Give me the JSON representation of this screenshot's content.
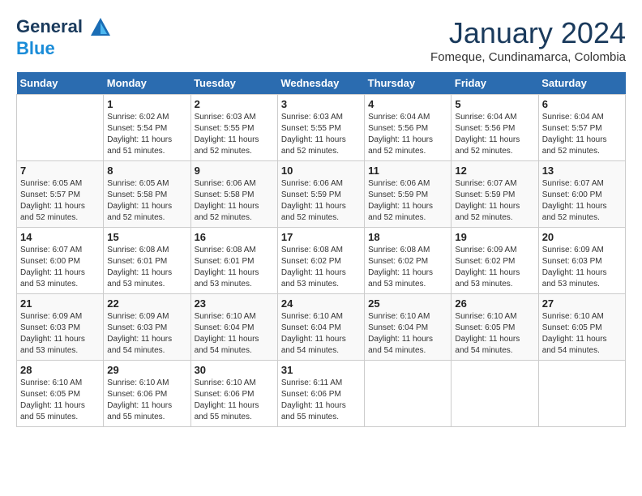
{
  "header": {
    "logo_line1": "General",
    "logo_line2": "Blue",
    "month": "January 2024",
    "location": "Fomeque, Cundinamarca, Colombia"
  },
  "weekdays": [
    "Sunday",
    "Monday",
    "Tuesday",
    "Wednesday",
    "Thursday",
    "Friday",
    "Saturday"
  ],
  "weeks": [
    [
      {
        "day": "",
        "sunrise": "",
        "sunset": "",
        "daylight": ""
      },
      {
        "day": "1",
        "sunrise": "Sunrise: 6:02 AM",
        "sunset": "Sunset: 5:54 PM",
        "daylight": "Daylight: 11 hours and 51 minutes."
      },
      {
        "day": "2",
        "sunrise": "Sunrise: 6:03 AM",
        "sunset": "Sunset: 5:55 PM",
        "daylight": "Daylight: 11 hours and 52 minutes."
      },
      {
        "day": "3",
        "sunrise": "Sunrise: 6:03 AM",
        "sunset": "Sunset: 5:55 PM",
        "daylight": "Daylight: 11 hours and 52 minutes."
      },
      {
        "day": "4",
        "sunrise": "Sunrise: 6:04 AM",
        "sunset": "Sunset: 5:56 PM",
        "daylight": "Daylight: 11 hours and 52 minutes."
      },
      {
        "day": "5",
        "sunrise": "Sunrise: 6:04 AM",
        "sunset": "Sunset: 5:56 PM",
        "daylight": "Daylight: 11 hours and 52 minutes."
      },
      {
        "day": "6",
        "sunrise": "Sunrise: 6:04 AM",
        "sunset": "Sunset: 5:57 PM",
        "daylight": "Daylight: 11 hours and 52 minutes."
      }
    ],
    [
      {
        "day": "7",
        "sunrise": "Sunrise: 6:05 AM",
        "sunset": "Sunset: 5:57 PM",
        "daylight": "Daylight: 11 hours and 52 minutes."
      },
      {
        "day": "8",
        "sunrise": "Sunrise: 6:05 AM",
        "sunset": "Sunset: 5:58 PM",
        "daylight": "Daylight: 11 hours and 52 minutes."
      },
      {
        "day": "9",
        "sunrise": "Sunrise: 6:06 AM",
        "sunset": "Sunset: 5:58 PM",
        "daylight": "Daylight: 11 hours and 52 minutes."
      },
      {
        "day": "10",
        "sunrise": "Sunrise: 6:06 AM",
        "sunset": "Sunset: 5:59 PM",
        "daylight": "Daylight: 11 hours and 52 minutes."
      },
      {
        "day": "11",
        "sunrise": "Sunrise: 6:06 AM",
        "sunset": "Sunset: 5:59 PM",
        "daylight": "Daylight: 11 hours and 52 minutes."
      },
      {
        "day": "12",
        "sunrise": "Sunrise: 6:07 AM",
        "sunset": "Sunset: 5:59 PM",
        "daylight": "Daylight: 11 hours and 52 minutes."
      },
      {
        "day": "13",
        "sunrise": "Sunrise: 6:07 AM",
        "sunset": "Sunset: 6:00 PM",
        "daylight": "Daylight: 11 hours and 52 minutes."
      }
    ],
    [
      {
        "day": "14",
        "sunrise": "Sunrise: 6:07 AM",
        "sunset": "Sunset: 6:00 PM",
        "daylight": "Daylight: 11 hours and 53 minutes."
      },
      {
        "day": "15",
        "sunrise": "Sunrise: 6:08 AM",
        "sunset": "Sunset: 6:01 PM",
        "daylight": "Daylight: 11 hours and 53 minutes."
      },
      {
        "day": "16",
        "sunrise": "Sunrise: 6:08 AM",
        "sunset": "Sunset: 6:01 PM",
        "daylight": "Daylight: 11 hours and 53 minutes."
      },
      {
        "day": "17",
        "sunrise": "Sunrise: 6:08 AM",
        "sunset": "Sunset: 6:02 PM",
        "daylight": "Daylight: 11 hours and 53 minutes."
      },
      {
        "day": "18",
        "sunrise": "Sunrise: 6:08 AM",
        "sunset": "Sunset: 6:02 PM",
        "daylight": "Daylight: 11 hours and 53 minutes."
      },
      {
        "day": "19",
        "sunrise": "Sunrise: 6:09 AM",
        "sunset": "Sunset: 6:02 PM",
        "daylight": "Daylight: 11 hours and 53 minutes."
      },
      {
        "day": "20",
        "sunrise": "Sunrise: 6:09 AM",
        "sunset": "Sunset: 6:03 PM",
        "daylight": "Daylight: 11 hours and 53 minutes."
      }
    ],
    [
      {
        "day": "21",
        "sunrise": "Sunrise: 6:09 AM",
        "sunset": "Sunset: 6:03 PM",
        "daylight": "Daylight: 11 hours and 53 minutes."
      },
      {
        "day": "22",
        "sunrise": "Sunrise: 6:09 AM",
        "sunset": "Sunset: 6:03 PM",
        "daylight": "Daylight: 11 hours and 54 minutes."
      },
      {
        "day": "23",
        "sunrise": "Sunrise: 6:10 AM",
        "sunset": "Sunset: 6:04 PM",
        "daylight": "Daylight: 11 hours and 54 minutes."
      },
      {
        "day": "24",
        "sunrise": "Sunrise: 6:10 AM",
        "sunset": "Sunset: 6:04 PM",
        "daylight": "Daylight: 11 hours and 54 minutes."
      },
      {
        "day": "25",
        "sunrise": "Sunrise: 6:10 AM",
        "sunset": "Sunset: 6:04 PM",
        "daylight": "Daylight: 11 hours and 54 minutes."
      },
      {
        "day": "26",
        "sunrise": "Sunrise: 6:10 AM",
        "sunset": "Sunset: 6:05 PM",
        "daylight": "Daylight: 11 hours and 54 minutes."
      },
      {
        "day": "27",
        "sunrise": "Sunrise: 6:10 AM",
        "sunset": "Sunset: 6:05 PM",
        "daylight": "Daylight: 11 hours and 54 minutes."
      }
    ],
    [
      {
        "day": "28",
        "sunrise": "Sunrise: 6:10 AM",
        "sunset": "Sunset: 6:05 PM",
        "daylight": "Daylight: 11 hours and 55 minutes."
      },
      {
        "day": "29",
        "sunrise": "Sunrise: 6:10 AM",
        "sunset": "Sunset: 6:06 PM",
        "daylight": "Daylight: 11 hours and 55 minutes."
      },
      {
        "day": "30",
        "sunrise": "Sunrise: 6:10 AM",
        "sunset": "Sunset: 6:06 PM",
        "daylight": "Daylight: 11 hours and 55 minutes."
      },
      {
        "day": "31",
        "sunrise": "Sunrise: 6:11 AM",
        "sunset": "Sunset: 6:06 PM",
        "daylight": "Daylight: 11 hours and 55 minutes."
      },
      {
        "day": "",
        "sunrise": "",
        "sunset": "",
        "daylight": ""
      },
      {
        "day": "",
        "sunrise": "",
        "sunset": "",
        "daylight": ""
      },
      {
        "day": "",
        "sunrise": "",
        "sunset": "",
        "daylight": ""
      }
    ]
  ]
}
